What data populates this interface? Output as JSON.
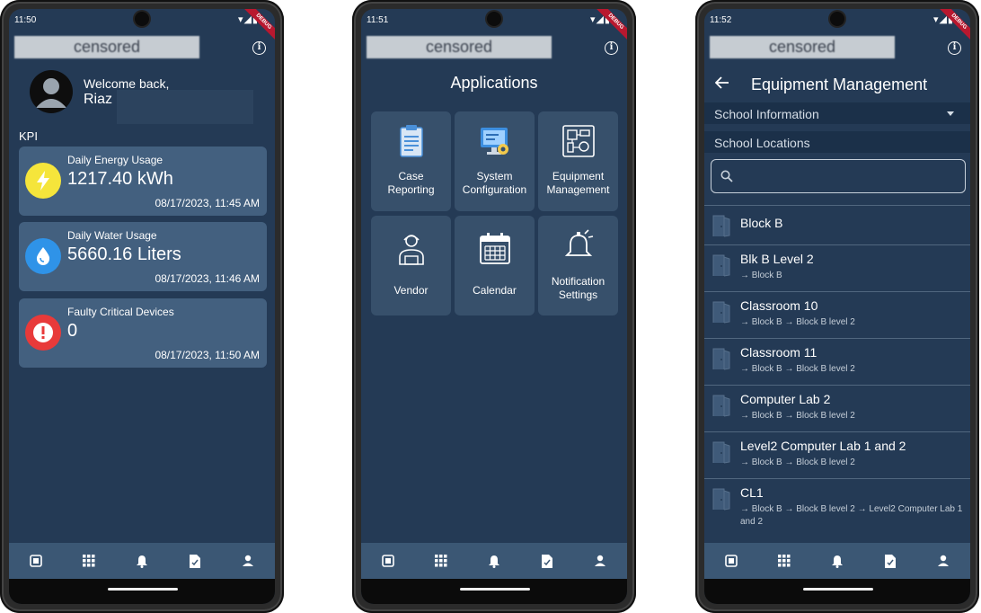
{
  "brand_text": "censored",
  "ribbon_text": "DEBUG",
  "screens": [
    {
      "time": "11:50",
      "welcome": "Welcome back,",
      "username": "Riaz",
      "kpi_label": "KPI",
      "kpis": [
        {
          "title": "Daily Energy Usage",
          "value": "1217.40 kWh",
          "timestamp": "08/17/2023, 11:45 AM",
          "icon": "lightning-icon",
          "color": "#f5e53b"
        },
        {
          "title": "Daily Water Usage",
          "value": "5660.16 Liters",
          "timestamp": "08/17/2023, 11:46 AM",
          "icon": "water-drop-icon",
          "color": "#2f93e8"
        },
        {
          "title": "Faulty Critical Devices",
          "value": "0",
          "timestamp": "08/17/2023, 11:50 AM",
          "icon": "alert-icon",
          "color": "#e83a3a"
        }
      ]
    },
    {
      "time": "11:51",
      "title": "Applications",
      "apps": [
        {
          "label_line1": "Case",
          "label_line2": "Reporting",
          "icon": "clipboard-icon"
        },
        {
          "label_line1": "System",
          "label_line2": "Configuration",
          "icon": "monitor-config-icon"
        },
        {
          "label_line1": "Equipment",
          "label_line2": "Management",
          "icon": "circuit-board-icon"
        },
        {
          "label_line1": "Vendor",
          "label_line2": "",
          "icon": "vendor-person-icon"
        },
        {
          "label_line1": "Calendar",
          "label_line2": "",
          "icon": "calendar-icon"
        },
        {
          "label_line1": "Notification",
          "label_line2": "Settings",
          "icon": "bell-settings-icon"
        }
      ]
    },
    {
      "time": "11:52",
      "title": "Equipment Management",
      "dropdown_label": "School Information",
      "section_label": "School Locations",
      "search_placeholder": "",
      "locations": [
        {
          "name": "Block B",
          "path": ""
        },
        {
          "name": "Blk B Level 2",
          "path": "→ Block B"
        },
        {
          "name": "Classroom 10",
          "path": "→ Block B → Block B level 2"
        },
        {
          "name": "Classroom 11",
          "path": "→ Block B → Block B level 2"
        },
        {
          "name": "Computer Lab 2",
          "path": "→ Block B → Block B level 2"
        },
        {
          "name": "Level2 Computer Lab 1 and 2",
          "path": "→ Block B → Block B level 2"
        },
        {
          "name": "CL1",
          "path": "→ Block B → Block B level 2 → Level2 Computer Lab 1 and 2"
        }
      ]
    }
  ],
  "nav_icons": [
    "dashboard-icon",
    "apps-grid-icon",
    "bell-icon",
    "report-icon",
    "profile-icon"
  ],
  "colors": {
    "screen_bg": "#243a55",
    "card_bg": "#43607f",
    "tile_bg": "#37506b",
    "nav_bg": "#3b5774"
  }
}
